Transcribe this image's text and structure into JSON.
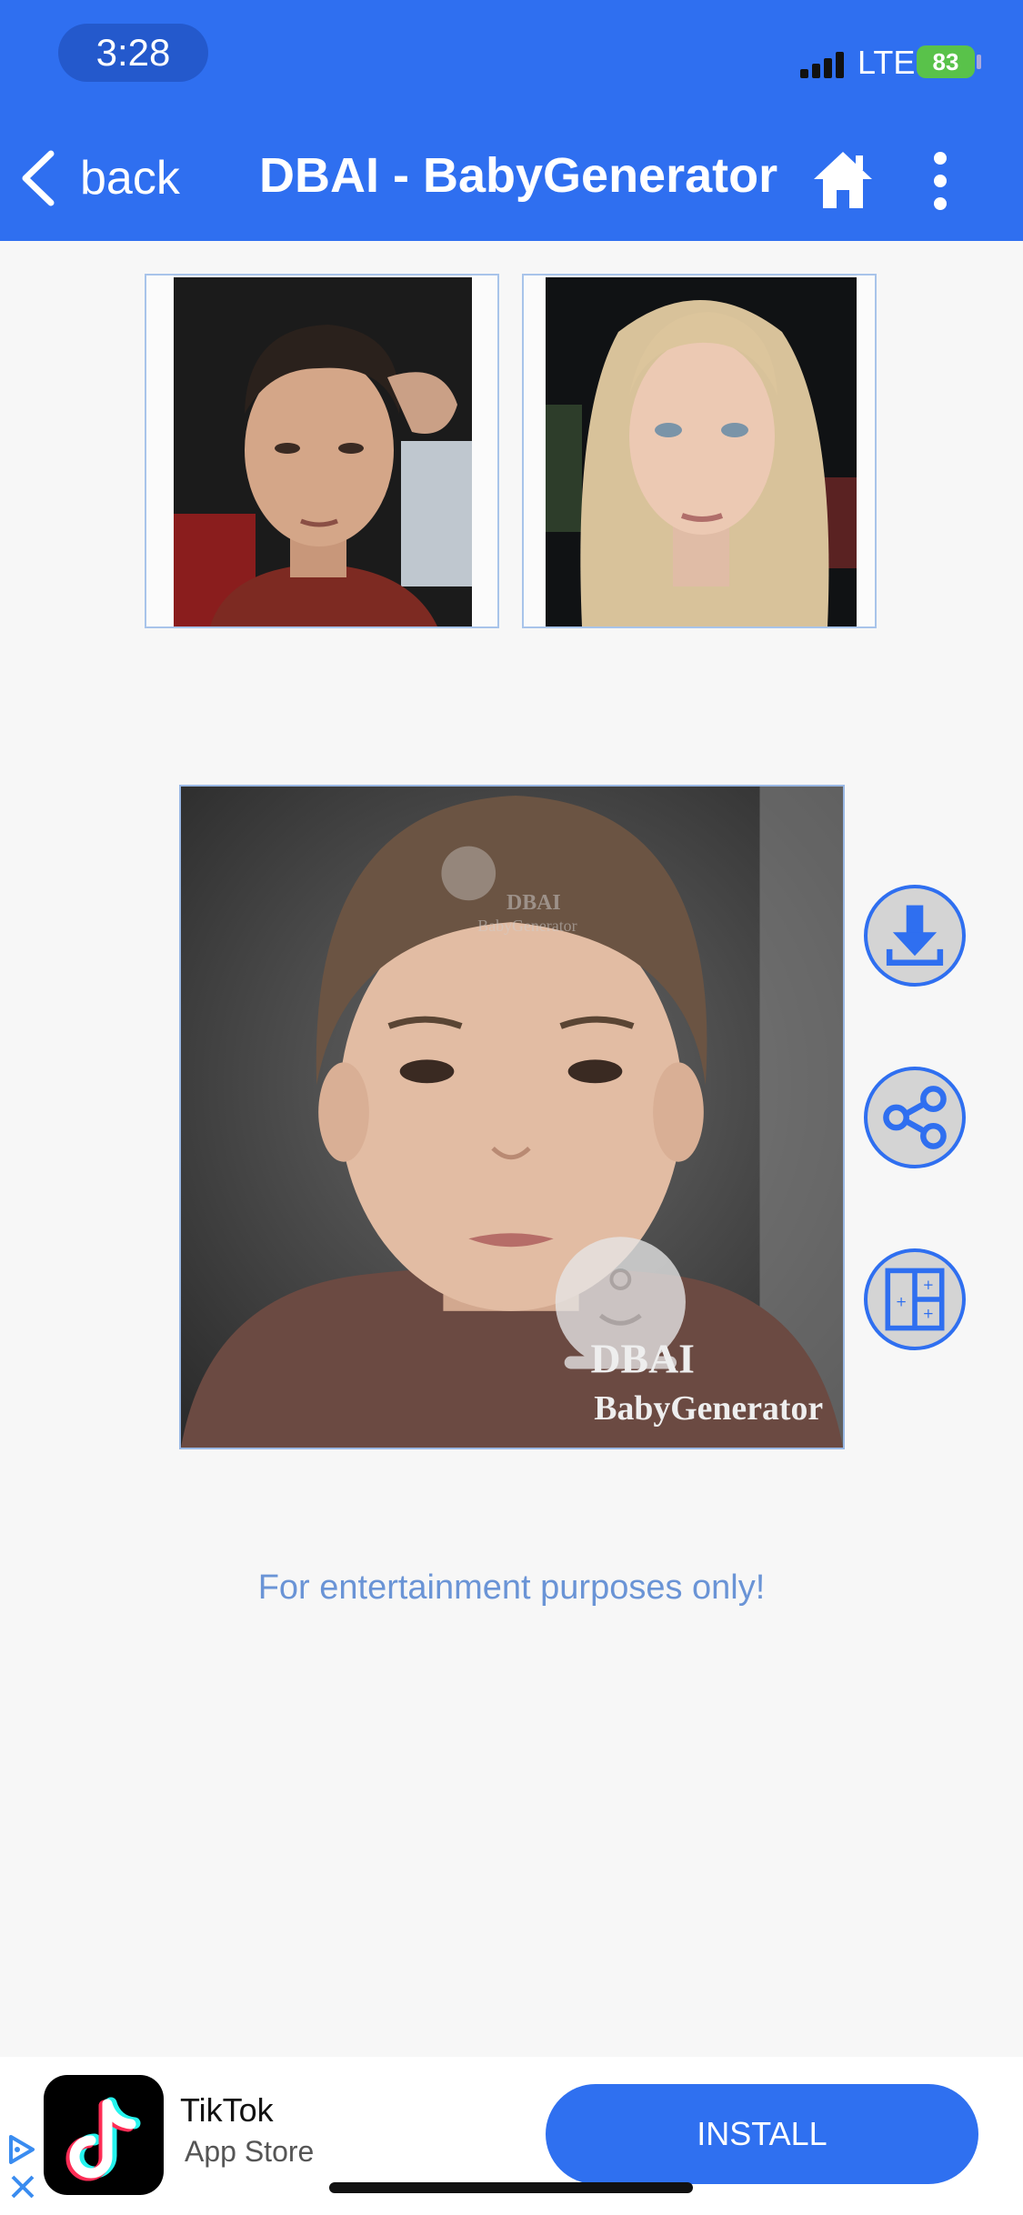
{
  "status_bar": {
    "time": "3:28",
    "network": "LTE",
    "battery": "83"
  },
  "header": {
    "back_label": "back",
    "title": "DBAI - BabyGenerator"
  },
  "result": {
    "watermark_brand": "DBAI",
    "watermark_product": "BabyGenerator"
  },
  "actions": [
    "download-icon",
    "share-icon",
    "layout-grid-icon"
  ],
  "disclaimer": "For entertainment purposes only!",
  "ad": {
    "app_name": "TikTok",
    "store": "App Store",
    "install_label": "INSTALL"
  },
  "colors": {
    "header": "#2f6ff0",
    "accent": "#2f6ff0",
    "disclaimer": "#6a94d6",
    "battery": "#59c24a"
  }
}
